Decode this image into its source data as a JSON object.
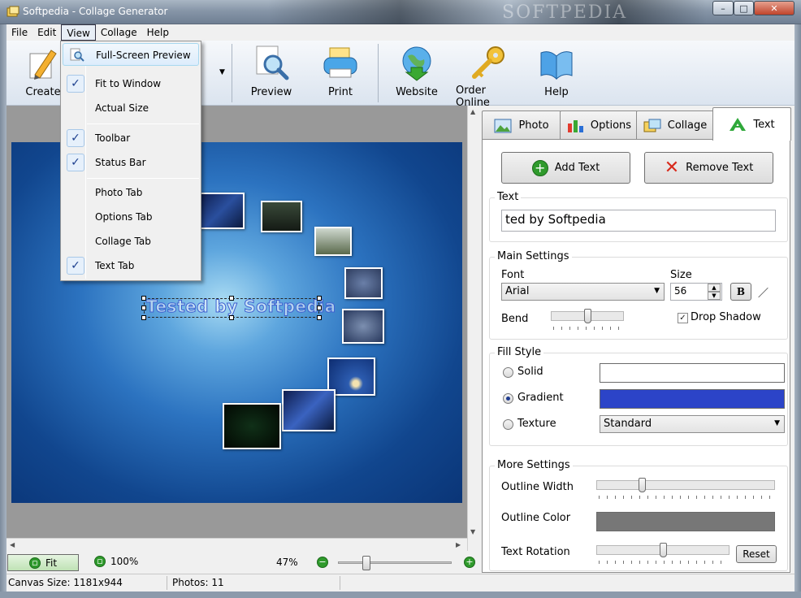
{
  "window": {
    "title": "Softpedia - Collage Generator",
    "watermark": "SOFTPEDIA",
    "minimize": "–",
    "maximize": "□",
    "close": "✕"
  },
  "menubar": [
    "File",
    "Edit",
    "View",
    "Collage",
    "Help"
  ],
  "toolbar": {
    "create": "Create",
    "preview": "Preview",
    "print": "Print",
    "website": "Website",
    "order_online": "Order Online",
    "help": "Help"
  },
  "view_menu": {
    "full_screen_preview": "Full-Screen Preview",
    "fit_to_window": "Fit to Window",
    "actual_size": "Actual Size",
    "toolbar": "Toolbar",
    "status_bar": "Status Bar",
    "photo_tab": "Photo Tab",
    "options_tab": "Options Tab",
    "collage_tab": "Collage Tab",
    "text_tab": "Text Tab",
    "check_glyph": "✓"
  },
  "canvas": {
    "text": "Tested by Softpedia"
  },
  "zoombar": {
    "fit": "Fit",
    "hundred": "100%",
    "zoom": "47%",
    "minus": "−",
    "plus": "+"
  },
  "statusbar": {
    "canvas_size": "Canvas Size: 1181x944",
    "photos": "Photos: 11"
  },
  "tabs": {
    "photo": "Photo",
    "options": "Options",
    "collage": "Collage",
    "text": "Text"
  },
  "text_panel": {
    "add_text": "Add Text",
    "remove_text": "Remove Text",
    "text_group": "Text",
    "text_value": "ted by Softpedia",
    "main_settings": "Main Settings",
    "font_label": "Font",
    "font_value": "Arial",
    "size_label": "Size",
    "size_value": "56",
    "bold": "B",
    "bend_label": "Bend",
    "drop_shadow": "Drop Shadow",
    "fill_style": "Fill Style",
    "solid": "Solid",
    "gradient": "Gradient",
    "texture": "Texture",
    "texture_value": "Standard",
    "more_settings": "More Settings",
    "outline_width": "Outline Width",
    "outline_color": "Outline Color",
    "text_rotation": "Text Rotation",
    "reset": "Reset",
    "colors": {
      "solid_swatch": "#ffffff",
      "gradient_swatch": "#2c44c8",
      "outline_swatch": "#777777"
    }
  }
}
